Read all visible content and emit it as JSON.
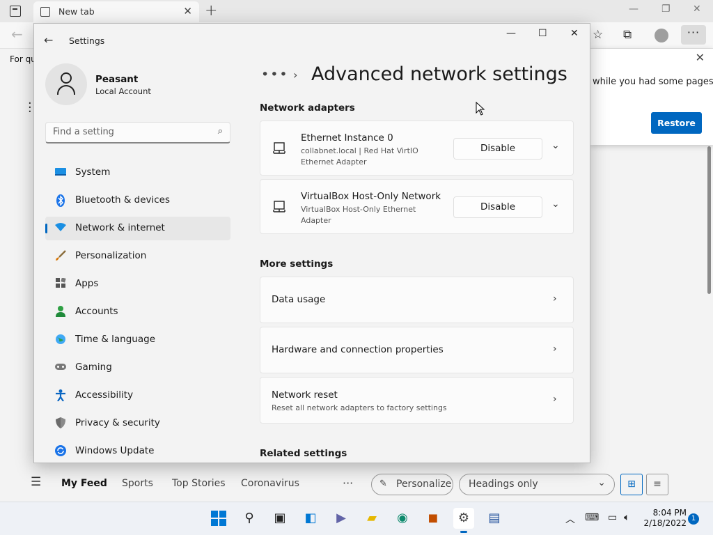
{
  "browser": {
    "tab_title": "New tab",
    "quick_links_text": "For qu",
    "popup_text": "while you had some pages",
    "restore_label": "Restore"
  },
  "feed": {
    "items": [
      "My Feed",
      "Sports",
      "Top Stories",
      "Coronavirus"
    ],
    "personalize_label": "Personalize",
    "view_select_value": "Headings only"
  },
  "settings": {
    "window_title": "Settings",
    "profile": {
      "name": "Peasant",
      "account_type": "Local Account"
    },
    "search_placeholder": "Find a setting",
    "nav": [
      {
        "label": "System",
        "icon": "system-icon",
        "color": "#0078d4"
      },
      {
        "label": "Bluetooth & devices",
        "icon": "bluetooth-icon",
        "color": "#0078d4"
      },
      {
        "label": "Network & internet",
        "icon": "wifi-icon",
        "color": "#0078d4"
      },
      {
        "label": "Personalization",
        "icon": "brush-icon",
        "color": "#d97706"
      },
      {
        "label": "Apps",
        "icon": "apps-icon",
        "color": "#555555"
      },
      {
        "label": "Accounts",
        "icon": "accounts-icon",
        "color": "#2ea043"
      },
      {
        "label": "Time & language",
        "icon": "globe-icon",
        "color": "#0078d4"
      },
      {
        "label": "Gaming",
        "icon": "gamepad-icon",
        "color": "#777777"
      },
      {
        "label": "Accessibility",
        "icon": "accessibility-icon",
        "color": "#0a66c2"
      },
      {
        "label": "Privacy & security",
        "icon": "shield-icon",
        "color": "#6b6b6b"
      },
      {
        "label": "Windows Update",
        "icon": "update-icon",
        "color": "#0078d4"
      }
    ],
    "selected_nav": "Network & internet",
    "breadcrumb_ellipsis": "•••",
    "page_title": "Advanced network settings",
    "network_adapters_heading": "Network adapters",
    "adapters": [
      {
        "name": "Ethernet Instance 0",
        "description": "collabnet.local | Red Hat VirtIO Ethernet Adapter",
        "button": "Disable"
      },
      {
        "name": "VirtualBox Host-Only Network",
        "description": "VirtualBox Host-Only Ethernet Adapter",
        "button": "Disable"
      }
    ],
    "more_settings_heading": "More settings",
    "more_settings": [
      {
        "label": "Data usage",
        "sub": ""
      },
      {
        "label": "Hardware and connection properties",
        "sub": ""
      },
      {
        "label": "Network reset",
        "sub": "Reset all network adapters to factory settings"
      }
    ],
    "related_settings_heading": "Related settings"
  },
  "taskbar": {
    "time": "8:04 PM",
    "date": "2/18/2022",
    "notification_count": "1"
  },
  "colors": {
    "accent": "#0067c0",
    "window_bg": "#f3f3f3",
    "card_bg": "#fbfbfb"
  }
}
